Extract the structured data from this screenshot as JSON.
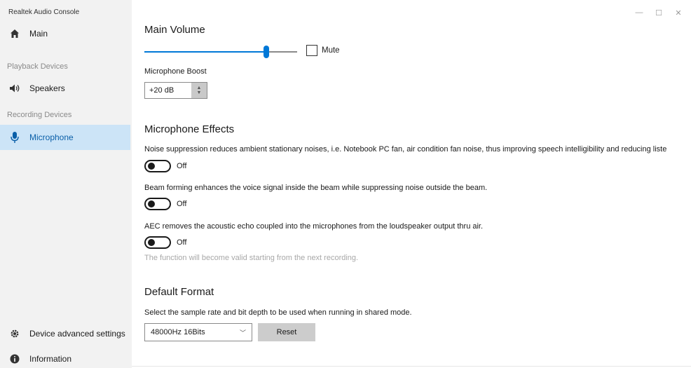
{
  "app": {
    "title": "Realtek Audio Console"
  },
  "window_controls": {
    "minimize": "—",
    "maximize": "☐",
    "close": "✕"
  },
  "sidebar": {
    "main": {
      "label": "Main",
      "icon": "home-icon"
    },
    "playback_header": "Playback Devices",
    "speakers": {
      "label": "Speakers",
      "icon": "speaker-icon"
    },
    "recording_header": "Recording Devices",
    "microphone": {
      "label": "Microphone",
      "icon": "microphone-icon",
      "selected": true
    },
    "advanced": {
      "label": "Device advanced settings",
      "icon": "gear-icon"
    },
    "information": {
      "label": "Information",
      "icon": "info-icon"
    }
  },
  "main_volume": {
    "title": "Main Volume",
    "level_fraction": 0.8,
    "mute_label": "Mute",
    "mute_checked": false
  },
  "mic_boost": {
    "label": "Microphone Boost",
    "value": "+20 dB"
  },
  "effects": {
    "title": "Microphone Effects",
    "noise_desc": "Noise suppression reduces ambient stationary noises, i.e. Notebook PC fan, air condition fan noise, thus improving speech intelligibility and reducing liste",
    "noise_state": "Off",
    "beam_desc": "Beam forming enhances the voice signal inside the beam while suppressing noise outside the beam.",
    "beam_state": "Off",
    "aec_desc": "AEC removes the acoustic echo coupled into the microphones from the loudspeaker output thru air.",
    "aec_state": "Off",
    "note": "The function will become valid starting from the next recording."
  },
  "format": {
    "title": "Default Format",
    "desc": "Select the sample rate and bit depth to be used when running in shared mode.",
    "selected": "48000Hz 16Bits",
    "reset_label": "Reset"
  },
  "colors": {
    "accent": "#0078d7",
    "selected_bg": "#cce4f7",
    "sidebar_bg": "#f2f2f2"
  }
}
